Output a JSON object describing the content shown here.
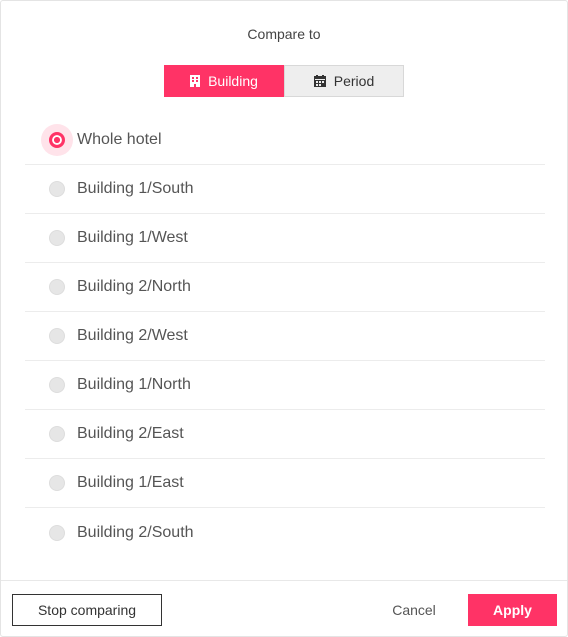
{
  "dialog": {
    "title": "Compare to"
  },
  "segmented": {
    "building_label": "Building",
    "building_icon": "building-icon",
    "period_label": "Period",
    "period_icon": "calendar-icon",
    "selected": "Building"
  },
  "options": [
    {
      "label": "Whole hotel",
      "checked": true
    },
    {
      "label": "Building 1/South",
      "checked": false
    },
    {
      "label": "Building 1/West",
      "checked": false
    },
    {
      "label": "Building 2/North",
      "checked": false
    },
    {
      "label": "Building 2/West",
      "checked": false
    },
    {
      "label": "Building 1/North",
      "checked": false
    },
    {
      "label": "Building 2/East",
      "checked": false
    },
    {
      "label": "Building 1/East",
      "checked": false
    },
    {
      "label": "Building 2/South",
      "checked": false
    }
  ],
  "footer": {
    "stop_label": "Stop comparing",
    "cancel_label": "Cancel",
    "apply_label": "Apply"
  },
  "colors": {
    "accent": "#ff3366",
    "segment_inactive": "#eeeeee"
  }
}
